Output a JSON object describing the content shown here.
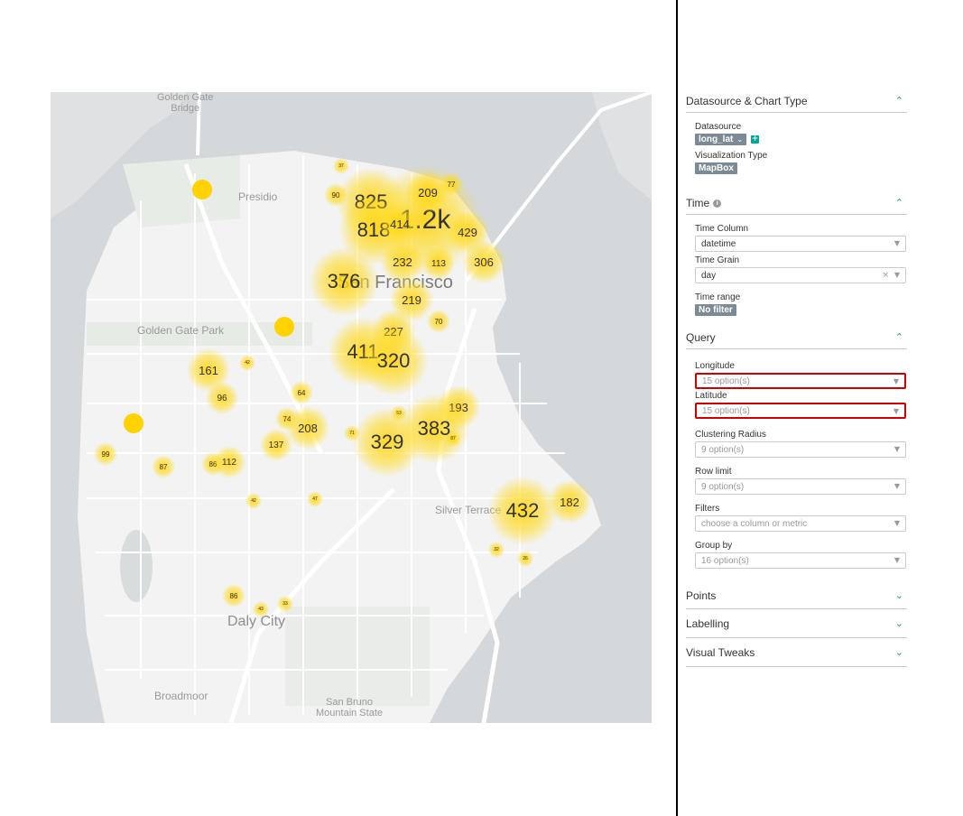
{
  "map": {
    "places": {
      "golden_gate_bridge": "Golden Gate\nBridge",
      "presidio": "Presidio",
      "san_francisco": "San Francisco",
      "golden_gate_park": "Golden Gate Park",
      "silver_terrace": "Silver Terrace",
      "daly_city": "Daly City",
      "broadmoor": "Broadmoor",
      "san_bruno": "San Bruno\nMountain State"
    },
    "clusters": [
      {
        "label": "1.2k",
        "size": "xl"
      },
      {
        "label": "825",
        "size": "lg"
      },
      {
        "label": "818",
        "size": "lg"
      },
      {
        "label": "209",
        "size": "md"
      },
      {
        "label": "414",
        "size": "md"
      },
      {
        "label": "429",
        "size": "md"
      },
      {
        "label": "77",
        "size": "xs"
      },
      {
        "label": "90",
        "size": "xs"
      },
      {
        "label": "37",
        "size": "xxs"
      },
      {
        "label": "232",
        "size": "md"
      },
      {
        "label": "113",
        "size": "sm"
      },
      {
        "label": "306",
        "size": "md"
      },
      {
        "label": "376",
        "size": "lg"
      },
      {
        "label": "219",
        "size": "md"
      },
      {
        "label": "227",
        "size": "md"
      },
      {
        "label": "70",
        "size": "xs"
      },
      {
        "label": "411",
        "size": "lg"
      },
      {
        "label": "320",
        "size": "lg"
      },
      {
        "label": "161",
        "size": "md"
      },
      {
        "label": "42",
        "size": "xxs"
      },
      {
        "label": "96",
        "size": "sm"
      },
      {
        "label": "64",
        "size": "xs"
      },
      {
        "label": "193",
        "size": "md"
      },
      {
        "label": "53",
        "size": "xxs"
      },
      {
        "label": "74",
        "size": "xs"
      },
      {
        "label": "208",
        "size": "md"
      },
      {
        "label": "71",
        "size": "xxs"
      },
      {
        "label": "383",
        "size": "lg"
      },
      {
        "label": "87",
        "size": "xxs"
      },
      {
        "label": "137",
        "size": "sm"
      },
      {
        "label": "329",
        "size": "lg"
      },
      {
        "label": "99",
        "size": "xs"
      },
      {
        "label": "87",
        "size": "xs"
      },
      {
        "label": "86",
        "size": "xs"
      },
      {
        "label": "112",
        "size": "sm"
      },
      {
        "label": "42",
        "size": "xxs"
      },
      {
        "label": "47",
        "size": "xxs"
      },
      {
        "label": "432",
        "size": "lg"
      },
      {
        "label": "182",
        "size": "md"
      },
      {
        "label": "32",
        "size": "xxs"
      },
      {
        "label": "26",
        "size": "xxs"
      },
      {
        "label": "86",
        "size": "xs"
      },
      {
        "label": "43",
        "size": "xxs"
      },
      {
        "label": "33",
        "size": "xxs"
      }
    ]
  },
  "panel": {
    "datasource_section": {
      "title": "Datasource & Chart Type",
      "datasource_label": "Datasource",
      "datasource_value": "long_lat",
      "viz_type_label": "Visualization Type",
      "viz_type_value": "MapBox"
    },
    "time_section": {
      "title": "Time",
      "time_column_label": "Time Column",
      "time_column_value": "datetime",
      "time_grain_label": "Time Grain",
      "time_grain_value": "day",
      "time_range_label": "Time range",
      "time_range_value": "No filter"
    },
    "query_section": {
      "title": "Query",
      "longitude_label": "Longitude",
      "longitude_value": "15 option(s)",
      "latitude_label": "Latitude",
      "latitude_value": "15 option(s)",
      "clustering_label": "Clustering Radius",
      "clustering_value": "9 option(s)",
      "row_limit_label": "Row limit",
      "row_limit_value": "9 option(s)",
      "filters_label": "Filters",
      "filters_placeholder": "choose a column or metric",
      "group_by_label": "Group by",
      "group_by_value": "16 option(s)"
    },
    "collapsed_sections": [
      "Points",
      "Labelling",
      "Visual Tweaks"
    ]
  },
  "colors": {
    "cluster": "#ffd200",
    "accent": "#00a699",
    "highlight": "#d00000",
    "tag": "#7b8a95"
  }
}
